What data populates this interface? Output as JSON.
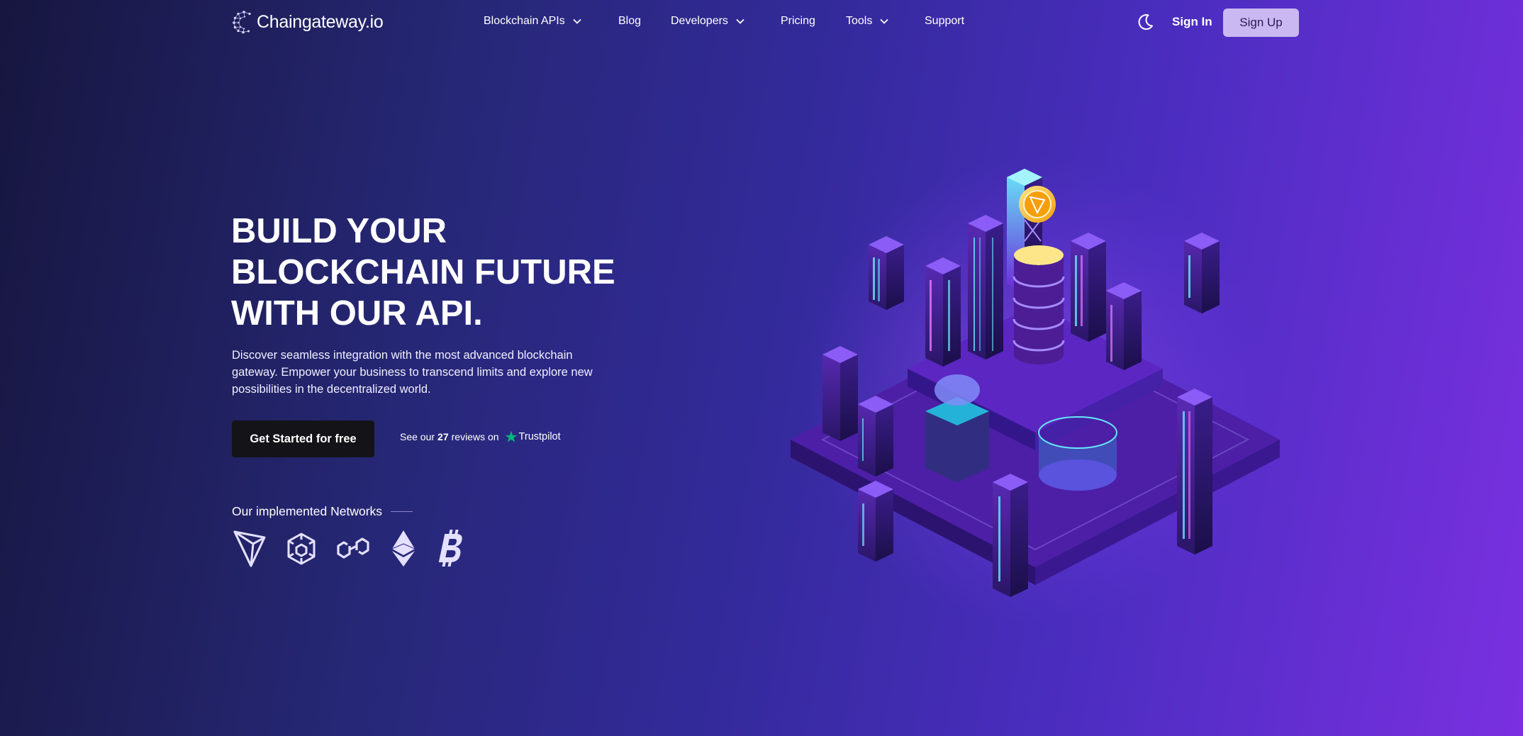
{
  "brand": {
    "name": "Chaingateway.io",
    "colors": {
      "accent": "#c9b8f2",
      "cta": "#141418",
      "trustpilot": "#00b67a"
    }
  },
  "nav": {
    "items": [
      {
        "label": "Blockchain APIs",
        "has_dropdown": true
      },
      {
        "label": "Blog",
        "has_dropdown": false
      },
      {
        "label": "Developers",
        "has_dropdown": true
      },
      {
        "label": "Pricing",
        "has_dropdown": false
      },
      {
        "label": "Tools",
        "has_dropdown": true
      },
      {
        "label": "Support",
        "has_dropdown": false
      }
    ],
    "theme_toggle_icon": "moon-icon",
    "sign_in": "Sign In",
    "sign_up": "Sign Up"
  },
  "hero": {
    "title_lines": [
      "BUILD YOUR",
      "BLOCKCHAIN FUTURE",
      "WITH OUR API."
    ],
    "description": "Discover seamless integration with the most advanced blockchain gateway. Empower your business to transcend limits and explore new possibilities in the decentralized world.",
    "cta": "Get Started for free",
    "reviews": {
      "prefix": "See our",
      "count": "27",
      "suffix": "reviews on",
      "platform": "Trustpilot"
    }
  },
  "networks": {
    "label": "Our implemented Networks",
    "icons": [
      "tron-icon",
      "bnb-icon",
      "polygon-icon",
      "ethereum-icon",
      "bitcoin-icon"
    ]
  },
  "illustration": {
    "icon": "isometric-blockchain-city-illustration"
  }
}
